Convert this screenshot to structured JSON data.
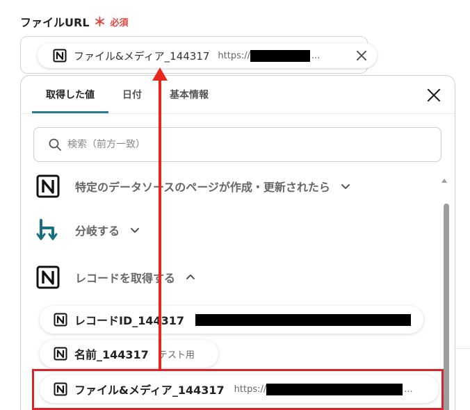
{
  "field": {
    "label": "ファイルURL",
    "required_mark": "＊",
    "required_text": "必須"
  },
  "selected_chip": {
    "name": "ファイル&メディア_144317",
    "url_prefix": "https://",
    "url_suffix": "..."
  },
  "popover": {
    "tabs": [
      {
        "label": "取得した値",
        "active": true
      },
      {
        "label": "日付",
        "active": false
      },
      {
        "label": "基本情報",
        "active": false
      }
    ],
    "search_placeholder": "検索（前方一致）",
    "groups": [
      {
        "label": "特定のデータソースのページが作成・更新されたら",
        "icon": "notion-icon",
        "expanded": false
      },
      {
        "label": "分岐する",
        "icon": "branch-icon",
        "expanded": false
      },
      {
        "label": "レコードを取得する",
        "icon": "notion-icon",
        "expanded": true
      }
    ],
    "items": [
      {
        "name": "レコードID_144317",
        "sub": ""
      },
      {
        "name": "名前_144317",
        "sub": "テスト用"
      },
      {
        "name": "ファイル&メディア_144317",
        "sub_prefix": "https://",
        "sub_suffix": "..."
      }
    ]
  },
  "colors": {
    "accent": "#2a7d8c",
    "required": "#e0463c",
    "highlight": "#d9232a",
    "arrow": "#e8261e",
    "branch_icon": "#1a6e82"
  }
}
